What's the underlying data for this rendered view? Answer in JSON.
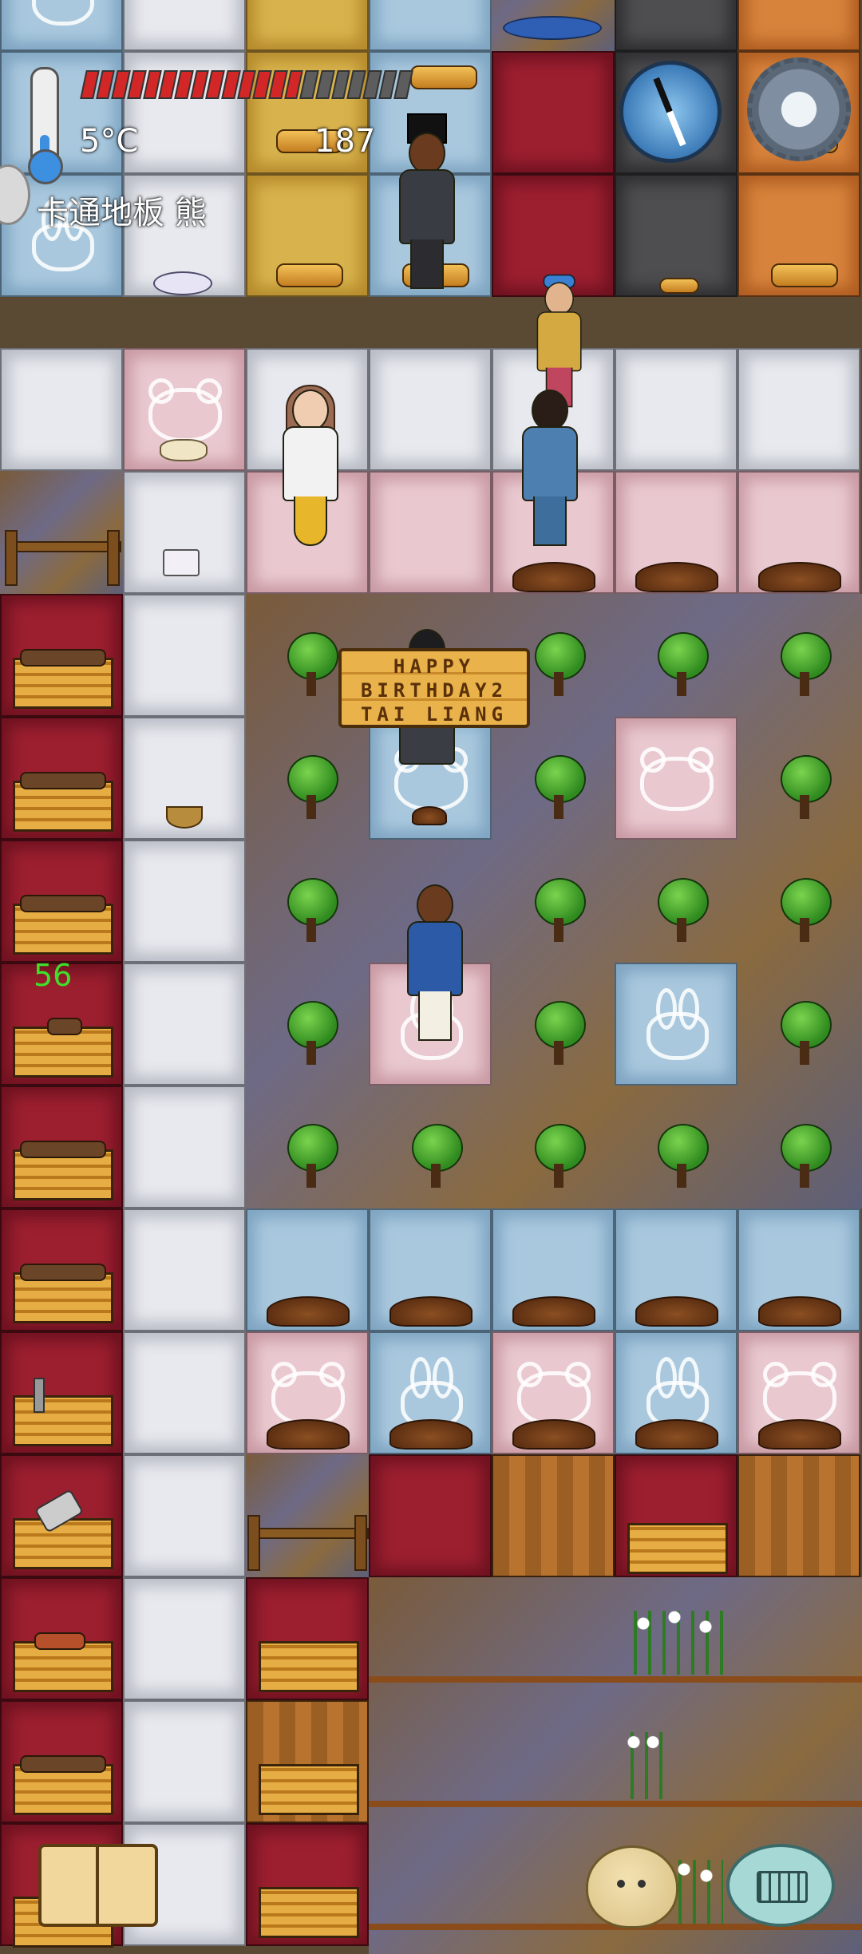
{
  "hud": {
    "temperature": "5°C",
    "counter": "187",
    "player_label": "卡通地板 熊",
    "floating_number": "56",
    "food_meter": {
      "filled": 14,
      "total": 21
    }
  },
  "world": {
    "sign": {
      "line1": "HAPPY",
      "line2": "BIRTHDAY2",
      "line3": "TAI LIANG"
    }
  },
  "icons": {
    "thermometer": "thermometer-icon",
    "compass": "compass-icon",
    "settings": "gear-icon",
    "tech_book": "book-icon",
    "emote": "emote-face-icon",
    "keyboard": "keyboard-chat-icon"
  },
  "colors": {
    "food_filled": "#d32727",
    "food_empty": "#5d5d5d",
    "floating_number": "#3ee02b"
  }
}
